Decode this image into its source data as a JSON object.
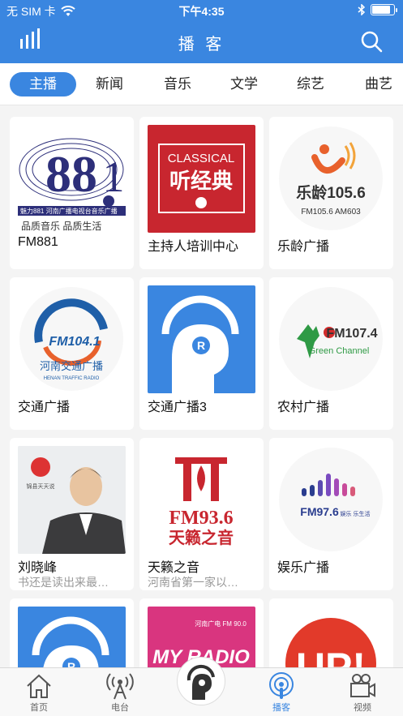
{
  "status": {
    "carrier": "无 SIM 卡",
    "time": "下午4:35"
  },
  "header": {
    "title": "播 客"
  },
  "tabs": [
    {
      "label": "主播",
      "active": true
    },
    {
      "label": "新闻"
    },
    {
      "label": "音乐"
    },
    {
      "label": "文学"
    },
    {
      "label": "综艺"
    },
    {
      "label": "曲艺"
    }
  ],
  "cards": [
    {
      "name": "FM881",
      "sub": "",
      "art": {
        "lines": [
          "魅力881 河南广播电视台音乐广播",
          "品质音乐  品质生活"
        ],
        "big": "881"
      }
    },
    {
      "name": "主持人培训中心",
      "sub": "",
      "art": {
        "lines": [
          "CLASSICAL",
          "听经典"
        ]
      }
    },
    {
      "name": "乐龄广播",
      "sub": "",
      "art": {
        "lines": [
          "乐龄105.6",
          "FM105.6  AM603"
        ]
      }
    },
    {
      "name": "交通广播",
      "sub": "",
      "art": {
        "lines": [
          "FM104.1",
          "河南交通广播",
          "HENAN TRAFFIC RADIO"
        ]
      }
    },
    {
      "name": "交通广播3",
      "sub": "",
      "art": {
        "lines": [
          "R"
        ]
      }
    },
    {
      "name": "农村广播",
      "sub": "",
      "art": {
        "lines": [
          "FM107.4",
          "Green Channel"
        ]
      }
    },
    {
      "name": "刘晓峰",
      "sub": "书还是读出来最…",
      "art": {
        "lines": [
          "锦县天天说"
        ]
      }
    },
    {
      "name": "天籁之音",
      "sub": "河南省第一家以…",
      "art": {
        "lines": [
          "FM93.6",
          "天籁之音"
        ]
      }
    },
    {
      "name": "娱乐广播",
      "sub": "",
      "art": {
        "lines": [
          "FM97.6",
          "娱乐 乐生活"
        ]
      }
    },
    {
      "name": "",
      "sub": "",
      "art": {
        "lines": [
          "R"
        ]
      }
    },
    {
      "name": "",
      "sub": "",
      "art": {
        "lines": [
          "MY RADIO",
          "河南广电 FM 90.0"
        ]
      }
    },
    {
      "name": "",
      "sub": "",
      "art": {
        "lines": [
          "UP!"
        ]
      }
    }
  ],
  "tabbar": [
    {
      "label": "首页",
      "icon": "home-icon"
    },
    {
      "label": "电台",
      "icon": "radio-tower-icon"
    },
    {
      "label": "",
      "icon": "player-avatar-icon"
    },
    {
      "label": "播客",
      "icon": "podcast-icon",
      "active": true
    },
    {
      "label": "视频",
      "icon": "video-camera-icon"
    }
  ],
  "colors": {
    "accent": "#3a86e0",
    "header": "#3a86e0",
    "red": "#c8262f"
  }
}
